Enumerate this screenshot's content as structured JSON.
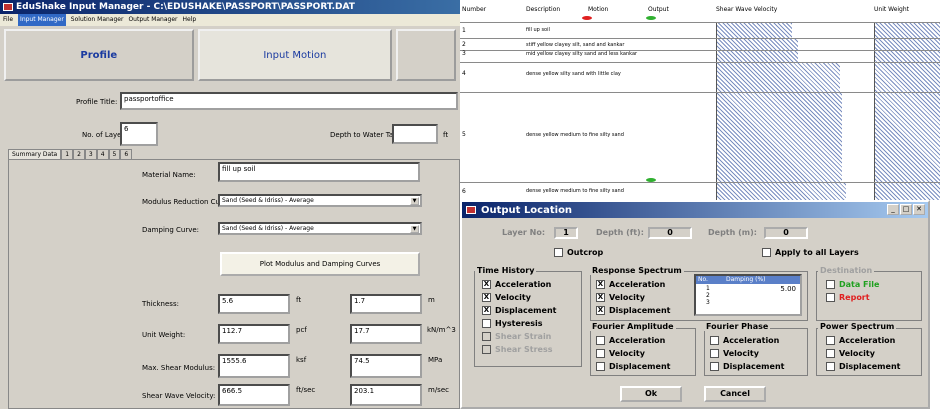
{
  "left": {
    "title": "EduShake Input Manager - C:\\EDUSHAKE\\PASSPORT\\PASSPORT.DAT",
    "menu": [
      "File",
      "Input Manager",
      "Solution Manager",
      "Output Manager",
      "Help"
    ],
    "tabs": {
      "profile": "Profile",
      "input_motion": "Input Motion"
    },
    "profile_title_label": "Profile Title:",
    "profile_title_value": "passportoffice",
    "layers_label": "No. of Layers:",
    "layers_value": "6",
    "water_label": "Depth to Water Table:",
    "water_unit": "ft",
    "subtabs": [
      "Summary Data",
      "1",
      "2",
      "3",
      "4",
      "5",
      "6"
    ],
    "material_label": "Material Name:",
    "material_value": "fill up soil",
    "modulus_label": "Modulus Reduction Curve:",
    "modulus_value": "Sand (Seed & Idriss) - Average",
    "damping_label": "Damping Curve:",
    "damping_value": "Sand (Seed & Idriss) - Average",
    "plot_button": "Plot Modulus and Damping Curves",
    "rows": [
      {
        "label": "Thickness:",
        "v1": "5.6",
        "u1": "ft",
        "v2": "1.7",
        "u2": "m"
      },
      {
        "label": "Unit Weight:",
        "v1": "112.7",
        "u1": "pcf",
        "v2": "17.7",
        "u2": "kN/m^3"
      },
      {
        "label": "Max. Shear Modulus:",
        "v1": "1555.6",
        "u1": "ksf",
        "v2": "74.5",
        "u2": "MPa"
      },
      {
        "label": "Shear Wave Velocity:",
        "v1": "666.5",
        "u1": "ft/sec",
        "v2": "203.1",
        "u2": "m/sec"
      }
    ]
  },
  "table": {
    "headers": [
      "Number",
      "Description",
      "Motion",
      "Output",
      "Shear Wave Velocity",
      "Unit Weight"
    ],
    "rows": [
      {
        "num": "1",
        "desc": "fill up soil"
      },
      {
        "num": "2",
        "desc": "stiff yellow clayey silt, sand and kankar"
      },
      {
        "num": "3",
        "desc": "mid yellow clayey silty sand and less kankar"
      },
      {
        "num": "4",
        "desc": "dense yellow silty sand with little clay"
      },
      {
        "num": "5",
        "desc": "dense yellow medium to fine silty sand"
      },
      {
        "num": "6",
        "desc": "dense yellow medium to fine silty sand"
      }
    ],
    "colors": {
      "motion": "#e02020",
      "output": "#30b030",
      "hatch": "#7a8ec0"
    }
  },
  "dialog": {
    "title": "Output Location",
    "layer_no_label": "Layer No:",
    "layer_no_value": "1",
    "depth_ft_label": "Depth (ft):",
    "depth_ft_value": "0",
    "depth_m_label": "Depth (m):",
    "depth_m_value": "0",
    "outcrop": "Outcrop",
    "apply_all": "Apply to all Layers",
    "time_history": {
      "title": "Time History",
      "items": [
        "Acceleration",
        "Velocity",
        "Displacement",
        "Hysteresis",
        "Shear Strain",
        "Shear Stress"
      ]
    },
    "response_spectrum": {
      "title": "Response Spectrum",
      "items": [
        "Acceleration",
        "Velocity",
        "Displacement"
      ],
      "list_headers": [
        "No.",
        "Damping (%)"
      ],
      "list_values": [
        "5.00"
      ],
      "list_nums": [
        "1",
        "2",
        "3"
      ]
    },
    "destination": {
      "title": "Destination",
      "items": [
        "Data File",
        "Report"
      ]
    },
    "fourier_amplitude": {
      "title": "Fourier Amplitude",
      "items": [
        "Acceleration",
        "Velocity",
        "Displacement"
      ]
    },
    "fourier_phase": {
      "title": "Fourier Phase",
      "items": [
        "Acceleration",
        "Velocity",
        "Displacement"
      ]
    },
    "power_spectrum": {
      "title": "Power Spectrum",
      "items": [
        "Acceleration",
        "Velocity",
        "Displacement"
      ]
    },
    "ok": "Ok",
    "cancel": "Cancel",
    "checked_mark": "X"
  }
}
